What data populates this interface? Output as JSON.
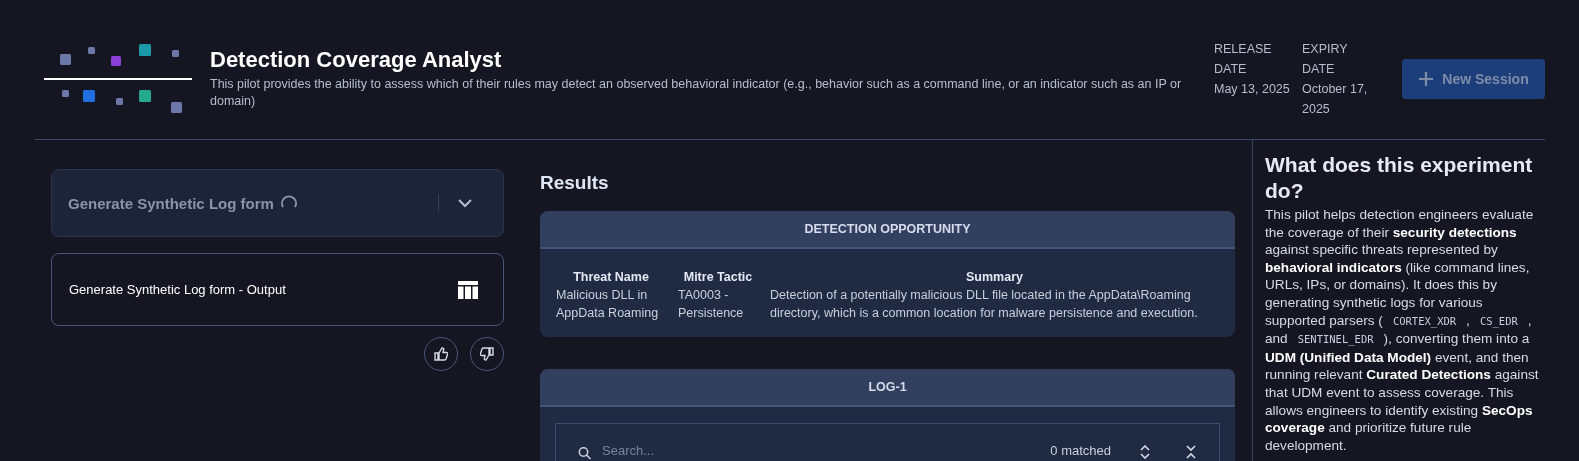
{
  "header": {
    "title": "Detection Coverage Analyst",
    "description": "This pilot provides the ability to assess which of their rules may detect an observed behavioral indicator (e.g., behavior such as a command line, or an indicator such as an IP or domain)",
    "dates": [
      {
        "label": "RELEASE DATE",
        "value": "May 13, 2025"
      },
      {
        "label": "EXPIRY DATE",
        "value": "October 17, 2025"
      }
    ],
    "new_session": {
      "label": "New Session",
      "disabled": true
    }
  },
  "left": {
    "form_panel": {
      "title": "Generate Synthetic Log form",
      "loading": true,
      "expanded": false
    },
    "output_card": {
      "title": "Generate Synthetic Log form - Output"
    }
  },
  "results": {
    "title": "Results",
    "detection": {
      "heading": "DETECTION OPPORTUNITY",
      "columns": [
        "Threat Name",
        "Mitre Tactic",
        "Summary"
      ],
      "row": [
        "Malicious DLL in AppData Roaming",
        "TA0003 - Persistence",
        "Detection of a potentially malicious DLL file located in the AppData\\Roaming directory, which is a common location for malware persistence and execution."
      ]
    },
    "log": {
      "heading": "LOG-1",
      "search_placeholder": "Search...",
      "matched": "0 matched"
    }
  },
  "info": {
    "title": "What does this experiment do?",
    "paragraph": [
      {
        "kind": "text",
        "text": "This pilot helps detection engineers evaluate the coverage of their **security detections** against specific threats represented by **behavioral indicators** (like command lines, URLs, IPs, or domains). It does this by generating synthetic logs for various supported parsers ("
      },
      {
        "kind": "code",
        "text": "CORTEX_XDR"
      },
      {
        "kind": "text",
        "text": ","
      },
      {
        "kind": "code",
        "text": "CS_EDR"
      },
      {
        "kind": "text",
        "text": ", and"
      },
      {
        "kind": "code",
        "text": "SENTINEL_EDR"
      },
      {
        "kind": "text",
        "text": "), converting them into a **UDM (Unified Data Model)** event, and then running relevant **Curated Detections** against that UDM event to assess coverage. This allows engineers to identify existing **SecOps coverage** and prioritize future rule development."
      }
    ]
  }
}
